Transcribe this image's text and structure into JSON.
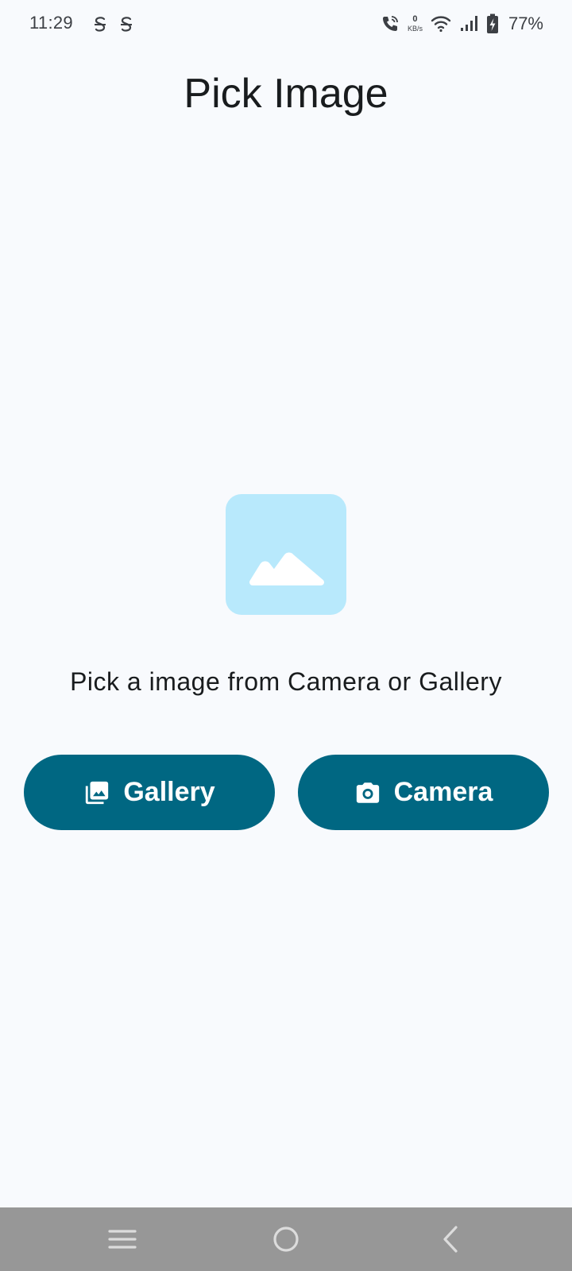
{
  "status_bar": {
    "time": "11:29",
    "network_speed_value": "0",
    "network_speed_unit": "KB/s",
    "battery_percent": "77%",
    "icons": [
      "notification-s-icon",
      "notification-s-icon",
      "wifi-calling-icon",
      "wifi-icon",
      "cellular-signal-icon",
      "battery-charging-icon"
    ]
  },
  "page": {
    "title": "Pick Image",
    "placeholder_icon": "image-placeholder-icon",
    "prompt": "Pick a image from Camera or Gallery"
  },
  "actions": {
    "gallery": {
      "label": "Gallery",
      "icon": "photo-library-icon"
    },
    "camera": {
      "label": "Camera",
      "icon": "camera-icon"
    }
  },
  "nav_bar": {
    "buttons": [
      "recents-icon",
      "home-icon",
      "back-icon"
    ]
  },
  "colors": {
    "background": "#f8fafd",
    "primary": "#006782",
    "on_primary": "#ffffff",
    "placeholder_bg": "#b8e9fc",
    "nav_bar": "#979797"
  }
}
